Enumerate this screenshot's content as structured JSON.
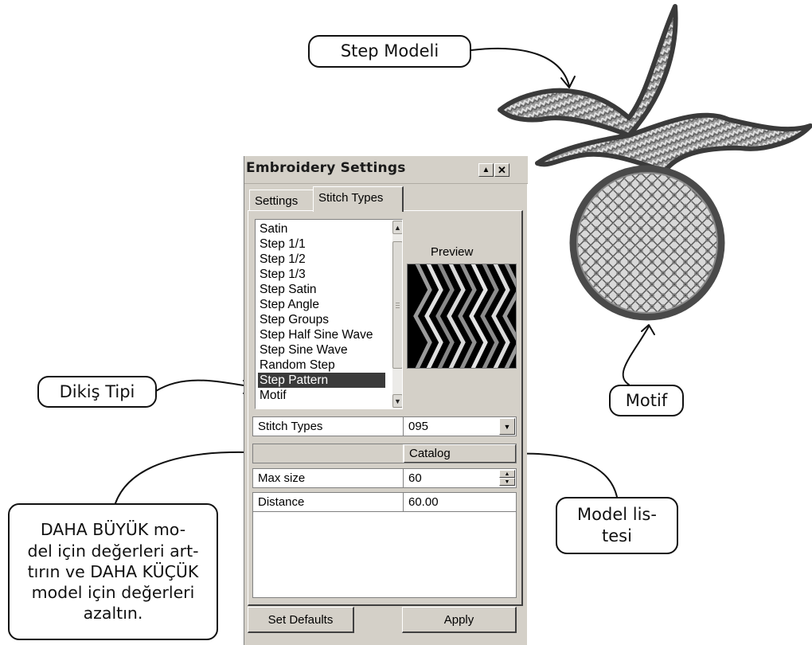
{
  "callouts": {
    "step_model": "Step Modeli",
    "stitch_type": "Dikiş Tipi",
    "motif": "Motif",
    "model_list": "Model lis-\ntesi",
    "size_hint": "DAHA BÜYÜK mo-\ndel için değerleri art-\ntırın ve DAHA KÜÇÜK\nmodel için değerleri\nazaltın."
  },
  "dialog": {
    "title": "Embroidery Settings",
    "minimize_glyph": "▲",
    "close_glyph": "✕",
    "tabs": [
      {
        "label": "Settings",
        "active": false
      },
      {
        "label": "Stitch Types",
        "active": true
      }
    ],
    "stitch_list": [
      "Satin",
      "Step 1/1",
      "Step 1/2",
      "Step 1/3",
      "Step Satin",
      "Step Angle",
      "Step Groups",
      "Step Half Sine Wave",
      "Step Sine Wave",
      "Random Step",
      "Step Pattern",
      "Motif"
    ],
    "selected_stitch": "Step Pattern",
    "preview_label": "Preview",
    "properties": {
      "stitch_types_label": "Stitch Types",
      "stitch_types_value": "095",
      "catalog_label": "Catalog",
      "max_size_label": "Max size",
      "max_size_value": "60",
      "distance_label": "Distance",
      "distance_value": "60.00"
    },
    "buttons": {
      "set_defaults": "Set Defaults",
      "apply": "Apply"
    }
  },
  "colors": {
    "dialog_face": "#d4d0c8",
    "selection": "#3a3a3a",
    "embroidery_dark": "#4a4a4a",
    "embroidery_light": "#bdbdbd"
  }
}
